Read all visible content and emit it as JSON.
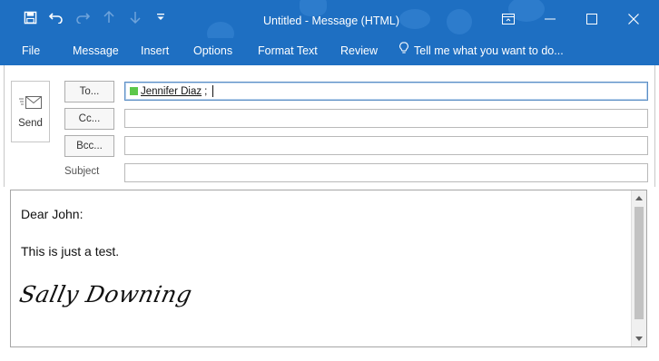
{
  "window": {
    "title": "Untitled - Message (HTML)",
    "accent": "#1e6fc2"
  },
  "qat": {
    "icons": [
      "save-icon",
      "undo-icon",
      "redo-icon",
      "up-arrow-icon",
      "down-arrow-icon",
      "customize-qat-icon"
    ]
  },
  "ribbon": {
    "tabs": [
      "File",
      "Message",
      "Insert",
      "Options",
      "Format Text",
      "Review"
    ],
    "tell_me": "Tell me what you want to do..."
  },
  "compose": {
    "send_label": "Send",
    "to_label": "To...",
    "cc_label": "Cc...",
    "bcc_label": "Bcc...",
    "subject_label": "Subject",
    "to_recipient": "Jennifer Diaz",
    "to_separator": ";",
    "cc_value": "",
    "bcc_value": "",
    "subject_value": ""
  },
  "body": {
    "greeting": "Dear John:",
    "text": "This is just a test.",
    "signature": "Sally Downing"
  }
}
